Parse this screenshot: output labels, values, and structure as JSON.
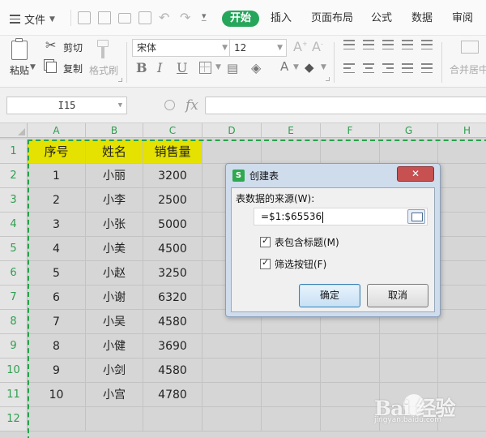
{
  "menubar": {
    "file_label": "文件",
    "tabs": [
      {
        "label": "开始",
        "active": true
      },
      {
        "label": "插入"
      },
      {
        "label": "页面布局"
      },
      {
        "label": "公式"
      },
      {
        "label": "数据"
      },
      {
        "label": "审阅"
      }
    ]
  },
  "ribbon": {
    "paste_label": "粘贴",
    "cut_label": "剪切",
    "copy_label": "复制",
    "format_painter_label": "格式刷",
    "font_name": "宋体",
    "font_size": "12",
    "merge_label": "合并居中"
  },
  "formula_bar": {
    "cell_ref": "I15",
    "fx_label": "fx",
    "formula": ""
  },
  "sheet": {
    "columns": [
      "A",
      "B",
      "C",
      "D",
      "E",
      "F",
      "G",
      "H"
    ],
    "rows": [
      "1",
      "2",
      "3",
      "4",
      "5",
      "6",
      "7",
      "8",
      "9",
      "10",
      "11",
      "12"
    ],
    "header": [
      "序号",
      "姓名",
      "销售量"
    ],
    "data": [
      [
        "1",
        "小丽",
        "3200"
      ],
      [
        "2",
        "小李",
        "2500"
      ],
      [
        "3",
        "小张",
        "5000"
      ],
      [
        "4",
        "小美",
        "4500"
      ],
      [
        "5",
        "小赵",
        "3250"
      ],
      [
        "6",
        "小谢",
        "6320"
      ],
      [
        "7",
        "小吴",
        "4580"
      ],
      [
        "8",
        "小健",
        "3690"
      ],
      [
        "9",
        "小剑",
        "4580"
      ],
      [
        "10",
        "小宫",
        "4780"
      ]
    ],
    "header_color": "#e5e100",
    "selection_color": "#27a14a"
  },
  "dialog": {
    "title": "创建表",
    "icon_letter": "S",
    "close_label": "✕",
    "source_label": "表数据的来源(W):",
    "range_value": "=$1:$65536",
    "checkbox_header_label": "表包含标题(M)",
    "checkbox_filter_label": "筛选按钮(F)",
    "ok_label": "确定",
    "cancel_label": "取消"
  },
  "watermark": {
    "brand": "Bai  经验",
    "url": "jingyan.baidu.com"
  }
}
